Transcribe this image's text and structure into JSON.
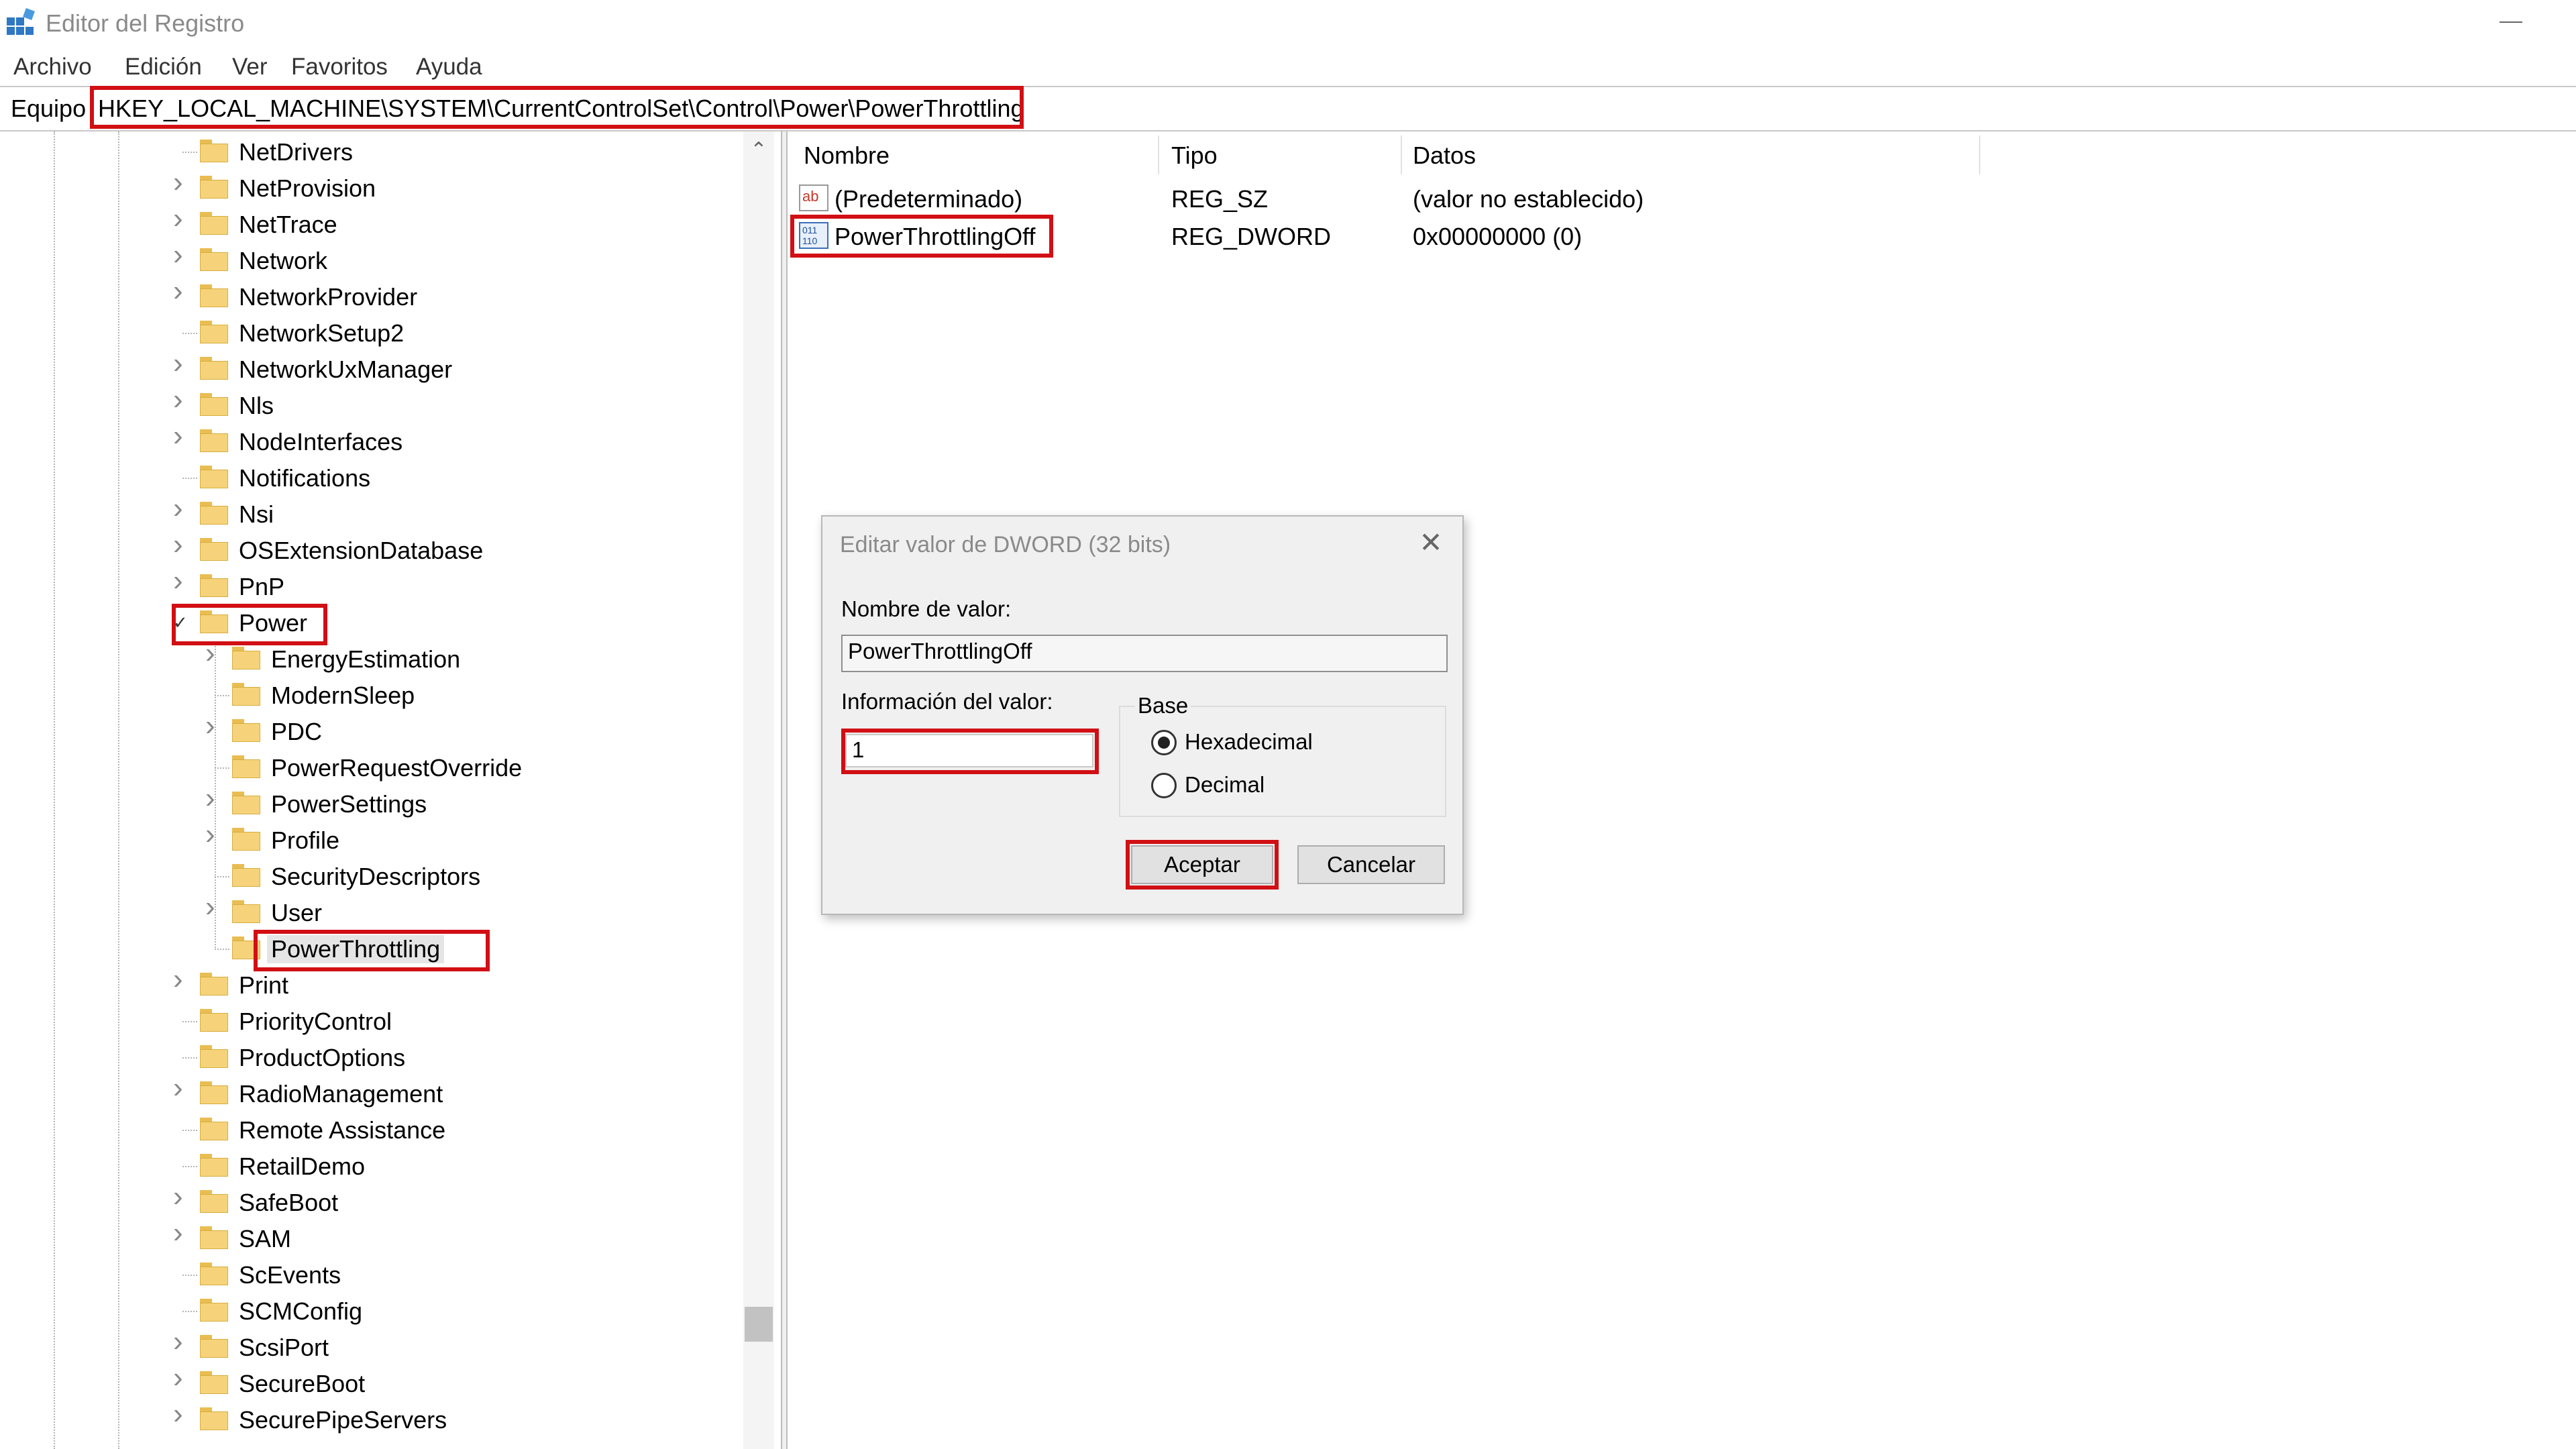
{
  "window": {
    "title": "Editor del Registro"
  },
  "menu": {
    "items": [
      "Archivo",
      "Edición",
      "Ver",
      "Favoritos",
      "Ayuda"
    ]
  },
  "address": {
    "label": "Equipo",
    "path": "HKEY_LOCAL_MACHINE\\SYSTEM\\CurrentControlSet\\Control\\Power\\PowerThrottling"
  },
  "tree": {
    "items": [
      {
        "label": "NetDrivers",
        "expandable": false,
        "level": 1
      },
      {
        "label": "NetProvision",
        "expandable": true,
        "level": 1
      },
      {
        "label": "NetTrace",
        "expandable": true,
        "level": 1
      },
      {
        "label": "Network",
        "expandable": true,
        "level": 1
      },
      {
        "label": "NetworkProvider",
        "expandable": true,
        "level": 1
      },
      {
        "label": "NetworkSetup2",
        "expandable": false,
        "level": 1
      },
      {
        "label": "NetworkUxManager",
        "expandable": true,
        "level": 1
      },
      {
        "label": "Nls",
        "expandable": true,
        "level": 1
      },
      {
        "label": "NodeInterfaces",
        "expandable": true,
        "level": 1
      },
      {
        "label": "Notifications",
        "expandable": false,
        "level": 1
      },
      {
        "label": "Nsi",
        "expandable": true,
        "level": 1
      },
      {
        "label": "OSExtensionDatabase",
        "expandable": true,
        "level": 1
      },
      {
        "label": "PnP",
        "expandable": true,
        "level": 1
      },
      {
        "label": "Power",
        "expandable": true,
        "expanded": true,
        "level": 1,
        "highlighted": true
      },
      {
        "label": "EnergyEstimation",
        "expandable": true,
        "level": 2
      },
      {
        "label": "ModernSleep",
        "expandable": false,
        "level": 2
      },
      {
        "label": "PDC",
        "expandable": true,
        "level": 2
      },
      {
        "label": "PowerRequestOverride",
        "expandable": false,
        "level": 2
      },
      {
        "label": "PowerSettings",
        "expandable": true,
        "level": 2
      },
      {
        "label": "Profile",
        "expandable": true,
        "level": 2
      },
      {
        "label": "SecurityDescriptors",
        "expandable": false,
        "level": 2
      },
      {
        "label": "User",
        "expandable": true,
        "level": 2
      },
      {
        "label": "PowerThrottling",
        "expandable": false,
        "level": 2,
        "selected": true,
        "highlighted": true
      },
      {
        "label": "Print",
        "expandable": true,
        "level": 1
      },
      {
        "label": "PriorityControl",
        "expandable": false,
        "level": 1
      },
      {
        "label": "ProductOptions",
        "expandable": false,
        "level": 1
      },
      {
        "label": "RadioManagement",
        "expandable": true,
        "level": 1
      },
      {
        "label": "Remote Assistance",
        "expandable": false,
        "level": 1
      },
      {
        "label": "RetailDemo",
        "expandable": false,
        "level": 1
      },
      {
        "label": "SafeBoot",
        "expandable": true,
        "level": 1
      },
      {
        "label": "SAM",
        "expandable": true,
        "level": 1
      },
      {
        "label": "ScEvents",
        "expandable": false,
        "level": 1
      },
      {
        "label": "SCMConfig",
        "expandable": false,
        "level": 1
      },
      {
        "label": "ScsiPort",
        "expandable": true,
        "level": 1
      },
      {
        "label": "SecureBoot",
        "expandable": true,
        "level": 1
      },
      {
        "label": "SecurePipeServers",
        "expandable": true,
        "level": 1
      }
    ]
  },
  "list": {
    "columns": [
      "Nombre",
      "Tipo",
      "Datos"
    ],
    "rows": [
      {
        "name": "(Predeterminado)",
        "type": "REG_SZ",
        "data": "(valor no establecido)",
        "icon": "string-value-icon"
      },
      {
        "name": "PowerThrottlingOff",
        "type": "REG_DWORD",
        "data": "0x00000000 (0)",
        "icon": "dword-value-icon",
        "highlighted": true
      }
    ]
  },
  "dialog": {
    "title": "Editar valor de DWORD (32 bits)",
    "name_label": "Nombre de valor:",
    "name_value": "PowerThrottlingOff",
    "data_label": "Información del valor:",
    "data_value": "1",
    "base_label": "Base",
    "base_options": [
      {
        "label": "Hexadecimal",
        "checked": true
      },
      {
        "label": "Decimal",
        "checked": false
      }
    ],
    "ok_label": "Aceptar",
    "cancel_label": "Cancelar"
  },
  "colors": {
    "highlight": "#d10f14",
    "folder": "#f6d37a",
    "dialog_bg": "#f0f0f0"
  }
}
